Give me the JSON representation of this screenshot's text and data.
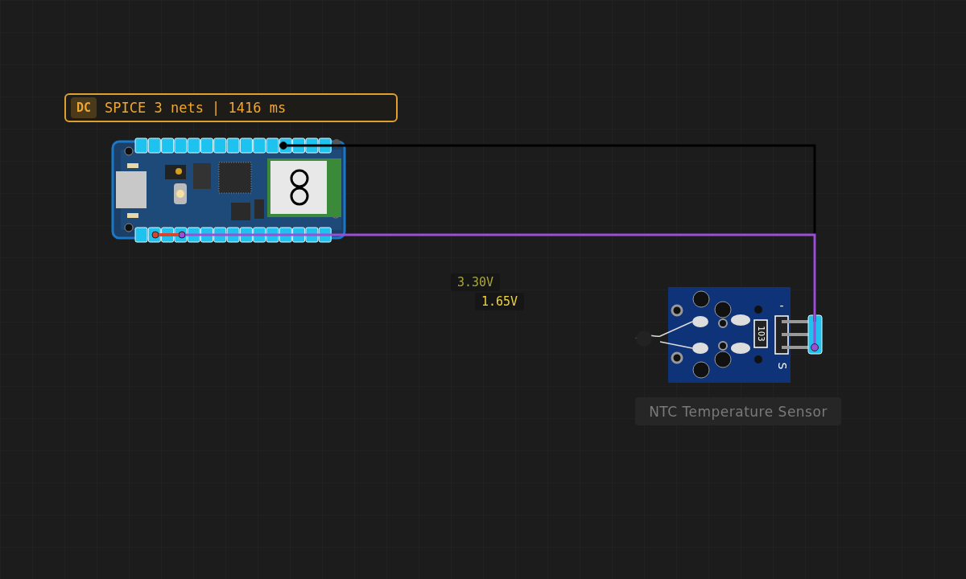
{
  "sim_status": {
    "mode": "DC",
    "text": "SPICE 3 nets | 1416 ms"
  },
  "wires": [
    {
      "color": "#000000"
    },
    {
      "color": "#9b4fd6"
    },
    {
      "color": "#d9432f"
    }
  ],
  "probes": [
    {
      "label": "3.30V"
    },
    {
      "label": "1.65V"
    }
  ],
  "components": [
    {
      "kind": "board"
    },
    {
      "kind": "ntc-sensor",
      "label": "NTC Temperature Sensor",
      "marks": [
        "-",
        "S",
        "103"
      ]
    }
  ]
}
